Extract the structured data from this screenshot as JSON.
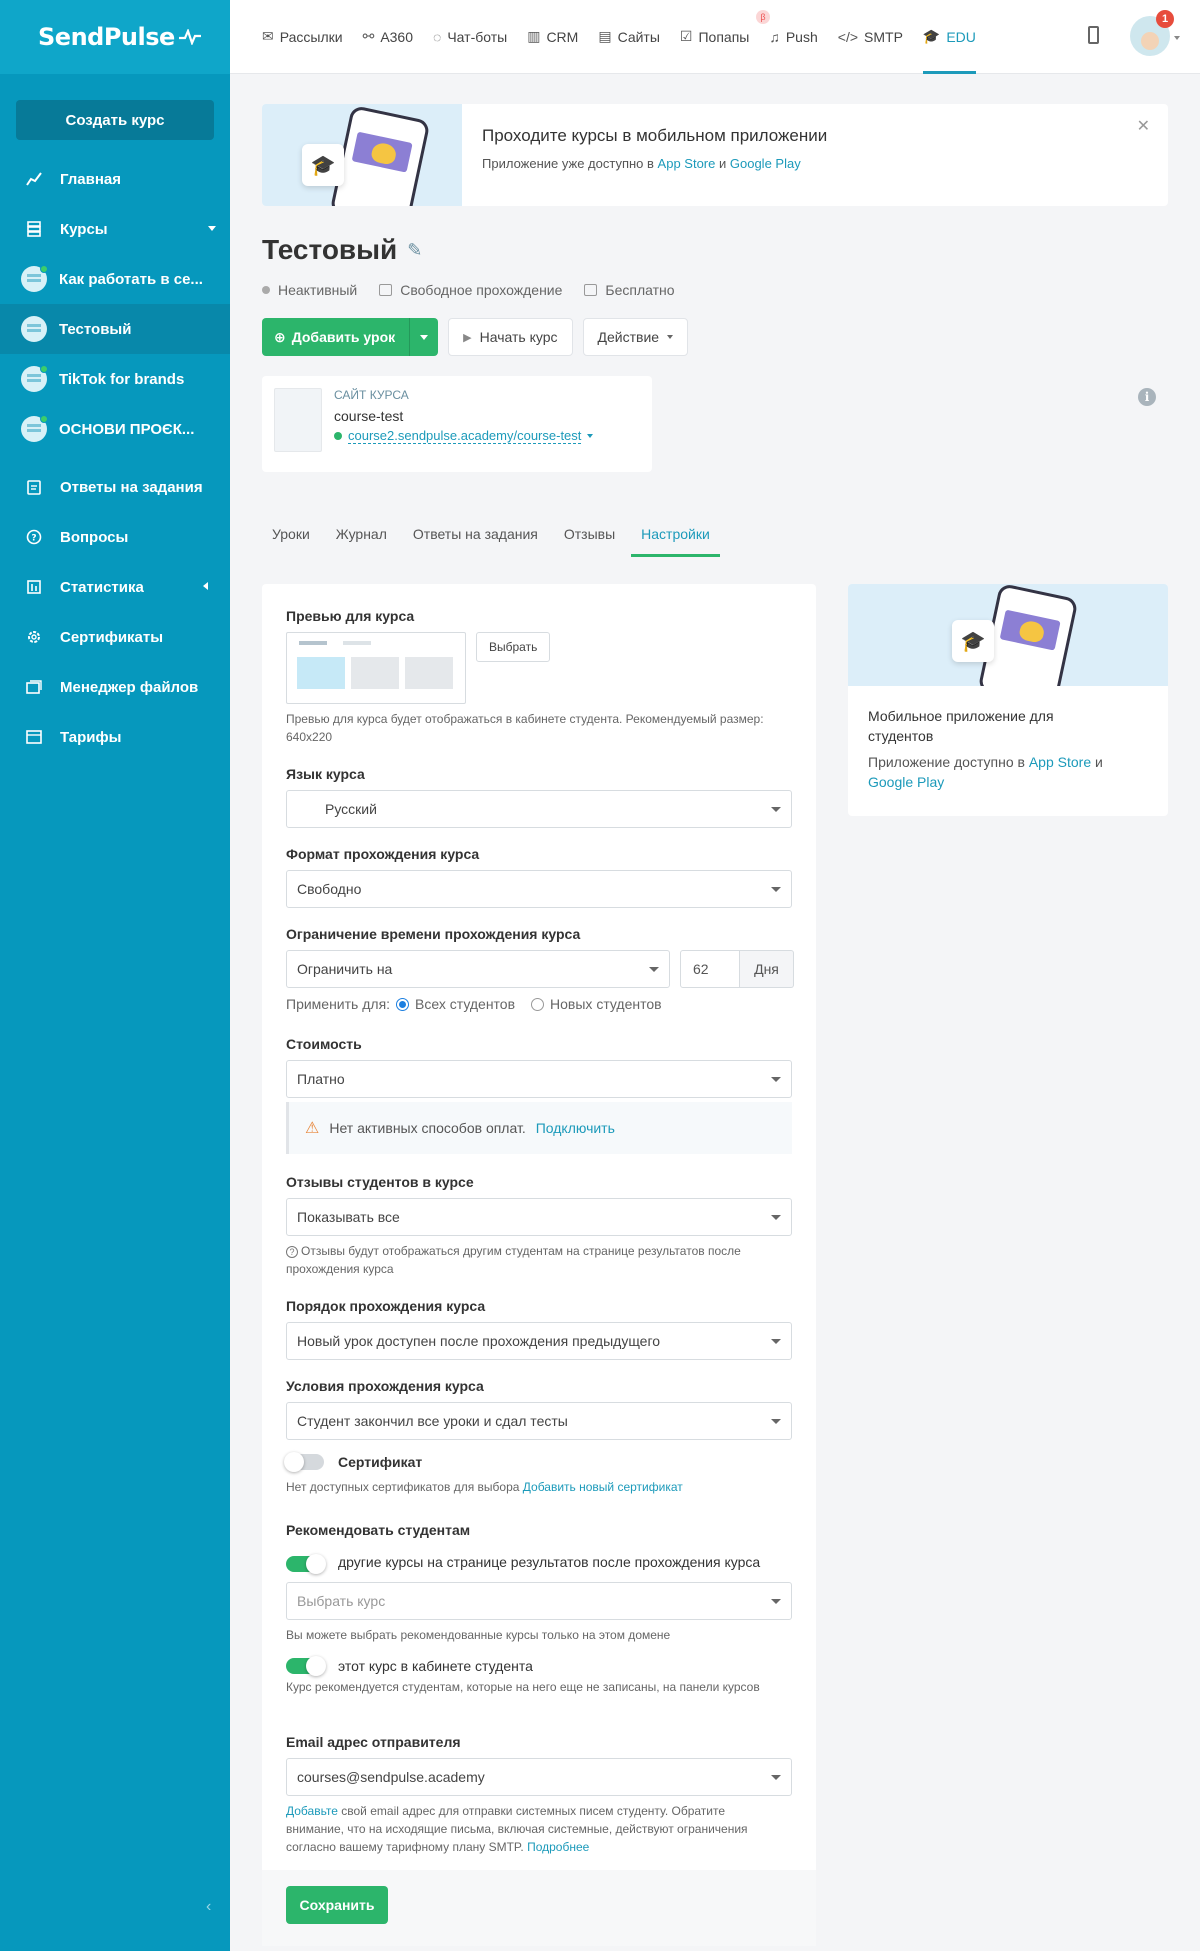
{
  "app": {
    "logo": "SendPulse"
  },
  "sidebar": {
    "create_label": "Создать курс",
    "items": [
      {
        "label": "Главная",
        "icon": "chart-line-icon"
      },
      {
        "label": "Курсы",
        "icon": "layers-icon"
      },
      {
        "label": "Как работать в се...",
        "icon": "course-avatar-icon"
      },
      {
        "label": "Тестовый",
        "icon": "course-avatar-icon"
      },
      {
        "label": "TikTok for brands",
        "icon": "course-avatar-icon"
      },
      {
        "label": "ОСНОВИ ПРОЄК...",
        "icon": "course-avatar-icon"
      },
      {
        "label": "Ответы на задания",
        "icon": "clipboard-icon"
      },
      {
        "label": "Вопросы",
        "icon": "question-icon"
      },
      {
        "label": "Статистика",
        "icon": "stats-icon"
      },
      {
        "label": "Сертификаты",
        "icon": "gear-icon"
      },
      {
        "label": "Менеджер файлов",
        "icon": "files-icon"
      },
      {
        "label": "Тарифы",
        "icon": "tariff-icon"
      }
    ]
  },
  "topbar": {
    "items": [
      {
        "label": "Рассылки",
        "icon": "mail-icon"
      },
      {
        "label": "A360",
        "icon": "automation-icon"
      },
      {
        "label": "Чат-боты",
        "icon": "chat-icon"
      },
      {
        "label": "CRM",
        "icon": "crm-icon"
      },
      {
        "label": "Сайты",
        "icon": "sites-icon"
      },
      {
        "label": "Попапы",
        "icon": "popup-icon",
        "badge": "β"
      },
      {
        "label": "Push",
        "icon": "bell-icon"
      },
      {
        "label": "SMTP",
        "icon": "code-icon"
      },
      {
        "label": "EDU",
        "icon": "graduation-icon"
      }
    ],
    "notifications": "1"
  },
  "banner": {
    "title": "Проходите курсы в мобильном приложении",
    "sub_prefix": "Приложение уже доступно в ",
    "app_store": "App Store",
    "and": " и ",
    "google_play": "Google Play"
  },
  "course": {
    "title": "Тестовый",
    "status": "Неактивный",
    "mode": "Свободное прохождение",
    "price": "Бесплатно"
  },
  "actions": {
    "add_lesson": "Добавить урок",
    "start_course": "Начать курс",
    "action": "Действие"
  },
  "site": {
    "label": "Сайт курса",
    "name": "course-test",
    "url": "course2.sendpulse.academy/course-test"
  },
  "tabs": [
    {
      "label": "Уроки"
    },
    {
      "label": "Журнал"
    },
    {
      "label": "Ответы на задания"
    },
    {
      "label": "Отзывы"
    },
    {
      "label": "Настройки"
    }
  ],
  "form": {
    "preview": {
      "label": "Превью для курса",
      "button": "Выбрать",
      "hint": "Превью для курса будет отображаться в кабинете студента. Рекомендуемый размер: 640x220"
    },
    "language": {
      "label": "Язык курса",
      "value": "Русский"
    },
    "format": {
      "label": "Формат прохождения курса",
      "value": "Свободно"
    },
    "time_limit": {
      "label": "Ограничение времени прохождения курса",
      "value": "Ограничить на",
      "days": "62",
      "unit": "Дня",
      "apply_label": "Применить для:",
      "opt_all": "Всех студентов",
      "opt_new": "Новых студентов"
    },
    "cost": {
      "label": "Стоимость",
      "value": "Платно",
      "warning": "Нет активных способов оплат.",
      "connect": "Подключить"
    },
    "reviews": {
      "label": "Отзывы студентов в курсе",
      "value": "Показывать все",
      "hint": "Отзывы будут отображаться другим студентам на странице результатов после прохождения курса"
    },
    "order": {
      "label": "Порядок прохождения курса",
      "value": "Новый урок доступен после прохождения предыдущего"
    },
    "conditions": {
      "label": "Условия прохождения курса",
      "value": "Студент закончил все уроки и сдал тесты"
    },
    "certificate": {
      "label": "Сертификат",
      "hint_prefix": "Нет доступных сертификатов для выбора ",
      "hint_link": "Добавить новый сертификат"
    },
    "recommend": {
      "label": "Рекомендовать студентам",
      "other_courses": "другие курсы на странице результатов после прохождения курса",
      "select_placeholder": "Выбрать курс",
      "select_hint": "Вы можете выбрать рекомендованные курсы только на этом домене",
      "this_course": "этот курс в кабинете студента",
      "this_course_hint": "Курс рекомендуется студентам, которые на него еще не записаны, на панели курсов"
    },
    "email": {
      "label": "Email адрес отправителя",
      "value": "courses@sendpulse.academy",
      "hint_link1": "Добавьте",
      "hint_text": " свой email адрес для отправки системных писем студенту. Обратите внимание, что на исходящие письма, включая системные, действуют ограничения согласно вашему тарифному плану SMTP. ",
      "hint_link2": "Подробнее"
    },
    "save": "Сохранить"
  },
  "side_card": {
    "title": "Мобильное приложение для студентов",
    "sub_prefix": "Приложение доступно в ",
    "app_store": "App Store",
    "and": " и ",
    "google_play": "Google Play"
  }
}
